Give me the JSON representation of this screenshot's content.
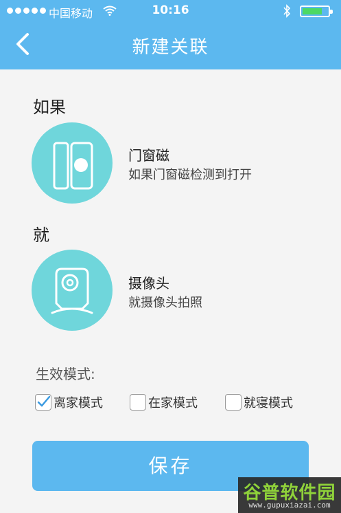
{
  "status_bar": {
    "carrier": "中国移动",
    "time": "10:16"
  },
  "header": {
    "title": "新建关联",
    "back_icon": "chevron-left-icon"
  },
  "condition": {
    "label": "如果",
    "device_name": "门窗磁",
    "description": "如果门窗磁检测到打开",
    "icon": "door-sensor-icon"
  },
  "action": {
    "label": "就",
    "device_name": "摄像头",
    "description": "就摄像头拍照",
    "icon": "camera-icon"
  },
  "modes": {
    "label": "生效模式:",
    "options": [
      {
        "label": "离家模式",
        "checked": true
      },
      {
        "label": "在家模式",
        "checked": false
      },
      {
        "label": "就寝模式",
        "checked": false
      }
    ]
  },
  "save_label": "保存",
  "watermark": {
    "title": "谷普软件园",
    "url": "www.gupuxiazai.com"
  },
  "colors": {
    "accent": "#5cb8ef",
    "icon_circle": "#6fd6db",
    "check": "#3a9ae0"
  }
}
